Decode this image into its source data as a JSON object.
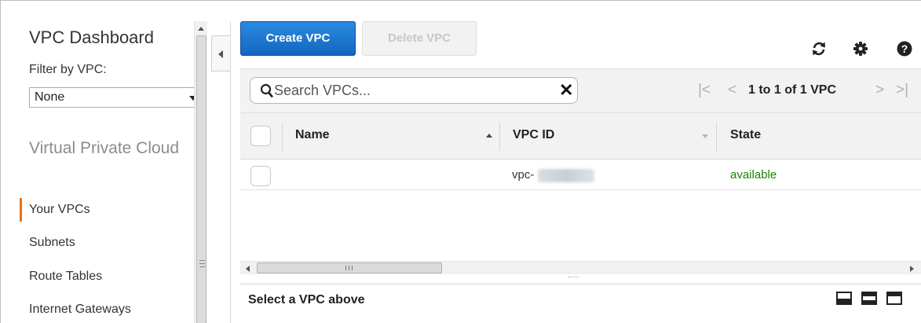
{
  "sidebar": {
    "title": "VPC Dashboard",
    "filter_label": "Filter by VPC:",
    "filter_value": "None",
    "section_title": "Virtual Private Cloud",
    "items": [
      {
        "label": "Your VPCs",
        "active": true
      },
      {
        "label": "Subnets",
        "active": false
      },
      {
        "label": "Route Tables",
        "active": false
      },
      {
        "label": "Internet Gateways",
        "active": false
      }
    ],
    "active_color": "#ec7211"
  },
  "toolbar": {
    "create_label": "Create VPC",
    "delete_label": "Delete VPC",
    "refresh_icon": "refresh-icon",
    "settings_icon": "gear-icon",
    "help_icon": "help-icon",
    "primary_color": "#1a73d0"
  },
  "search": {
    "placeholder": "Search VPCs...",
    "clear_icon": "close-icon"
  },
  "pagination": {
    "text": "1 to 1 of 1 VPC"
  },
  "table": {
    "columns": [
      "Name",
      "VPC ID",
      "State"
    ],
    "rows": [
      {
        "name": "",
        "vpc_id": "vpc-",
        "state": "available"
      }
    ],
    "state_color": "#1d8102"
  },
  "detail": {
    "label": "Select a VPC above"
  }
}
